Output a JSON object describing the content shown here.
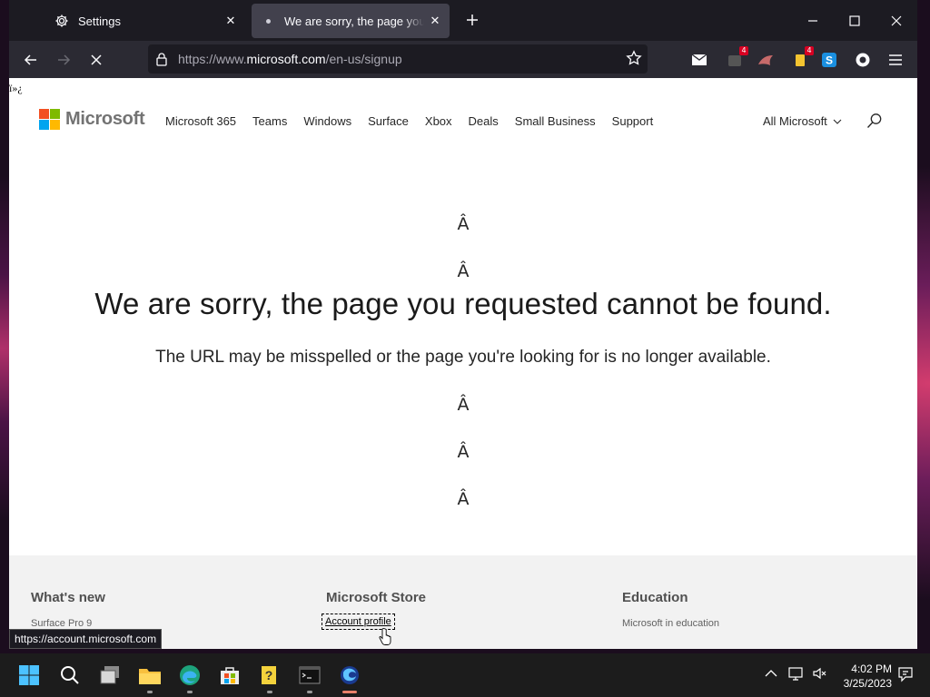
{
  "browser": {
    "tabs": [
      {
        "title": "Settings",
        "icon": "gear-icon",
        "active": false
      },
      {
        "title": "We are sorry, the page you requested cannot be found.",
        "icon": "loading-dot-icon",
        "active": true
      }
    ],
    "url_prefix": "https://www.",
    "url_domain": "microsoft.com",
    "url_path": "/en-us/signup",
    "extensions": [
      {
        "name": "mail-icon",
        "badge": ""
      },
      {
        "name": "red-badge-extension-icon",
        "badge": "4"
      },
      {
        "name": "shark-extension-icon",
        "badge": ""
      },
      {
        "name": "yellow-extension-icon",
        "badge": "4"
      },
      {
        "name": "skype-icon",
        "badge": ""
      },
      {
        "name": "circle-extension-icon",
        "badge": ""
      }
    ]
  },
  "page": {
    "bom_text": "ï»¿",
    "logo_text": "Microsoft",
    "logo_colors": [
      "#f25022",
      "#7fba00",
      "#00a4ef",
      "#ffb900"
    ],
    "nav": [
      "Microsoft 365",
      "Teams",
      "Windows",
      "Surface",
      "Xbox",
      "Deals",
      "Small Business",
      "Support"
    ],
    "all_microsoft": "All Microsoft",
    "glyph": "Â",
    "error_title": "We are sorry, the page you requested cannot be found.",
    "error_subtitle": "The URL may be misspelled or the page you're looking for is no longer available.",
    "footer": [
      {
        "heading": "What's new",
        "link": "Surface Pro 9"
      },
      {
        "heading": "Microsoft Store",
        "link": "Account profile"
      },
      {
        "heading": "Education",
        "link": "Microsoft in education"
      }
    ],
    "status_url": "https://account.microsoft.com"
  },
  "taskbar": {
    "time": "4:02 PM",
    "date": "3/25/2023"
  }
}
